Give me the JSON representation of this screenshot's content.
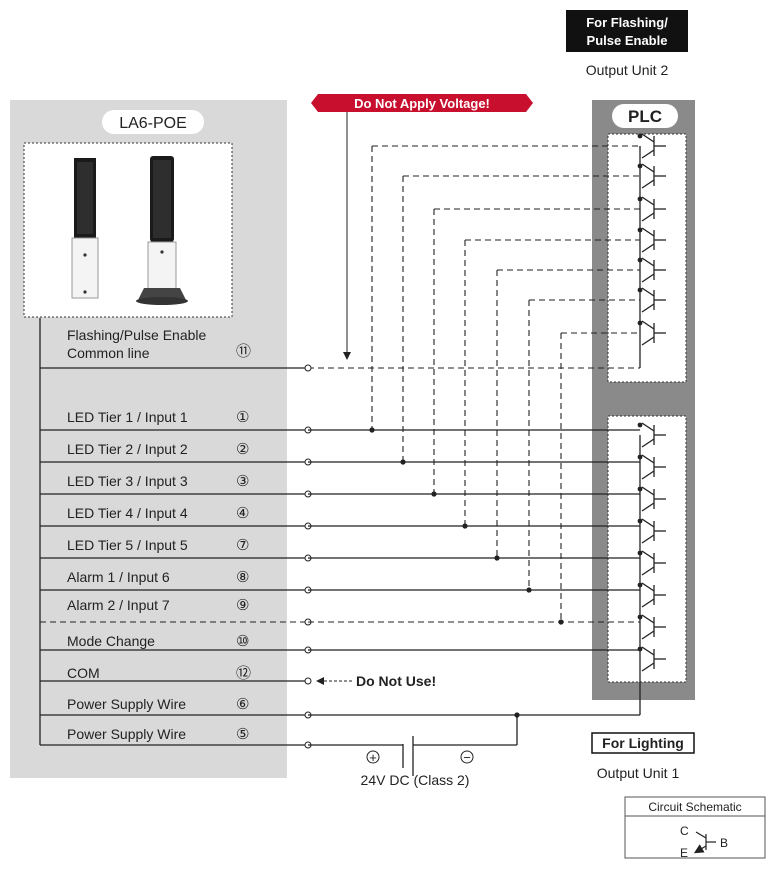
{
  "device_panel": {
    "title": "LA6-POE",
    "common_line_label_1": "Flashing/Pulse Enable",
    "common_line_label_2": "Common line",
    "common_line_num": "⑪"
  },
  "plc": {
    "title": "PLC"
  },
  "wires": [
    {
      "label": "LED Tier 1 / Input 1",
      "num": "①"
    },
    {
      "label": "LED Tier 2 / Input 2",
      "num": "②"
    },
    {
      "label": "LED Tier 3 / Input 3",
      "num": "③"
    },
    {
      "label": "LED Tier 4 / Input 4",
      "num": "④"
    },
    {
      "label": "LED Tier 5 / Input 5",
      "num": "⑦"
    },
    {
      "label": "Alarm 1 / Input 6",
      "num": "⑧"
    },
    {
      "label": "Alarm 2 / Input 7",
      "num": "⑨"
    },
    {
      "label": "Mode Change",
      "num": "⑩"
    },
    {
      "label": "COM",
      "num": "⑫"
    },
    {
      "label": "Power Supply Wire",
      "num": "⑥"
    },
    {
      "label": "Power Supply Wire",
      "num": "⑤"
    }
  ],
  "annotations": {
    "do_not_apply": "Do Not Apply Voltage!",
    "do_not_use": "Do Not Use!",
    "power_source": "24V DC (Class 2)",
    "plus": "+",
    "minus": "−"
  },
  "flashing_unit": {
    "badge_line1": "For Flashing/",
    "badge_line2": "Pulse Enable",
    "caption": "Output Unit 2"
  },
  "lighting_unit": {
    "badge": "For Lighting",
    "caption": "Output Unit 1"
  },
  "schematic": {
    "title": "Circuit Schematic",
    "c": "C",
    "b": "B",
    "e": "E"
  },
  "colors": {
    "panel_gray": "#d9d9d9",
    "plc_gray": "#8a8a8a",
    "banner_red": "#c8102e",
    "badge_black": "#111111"
  }
}
